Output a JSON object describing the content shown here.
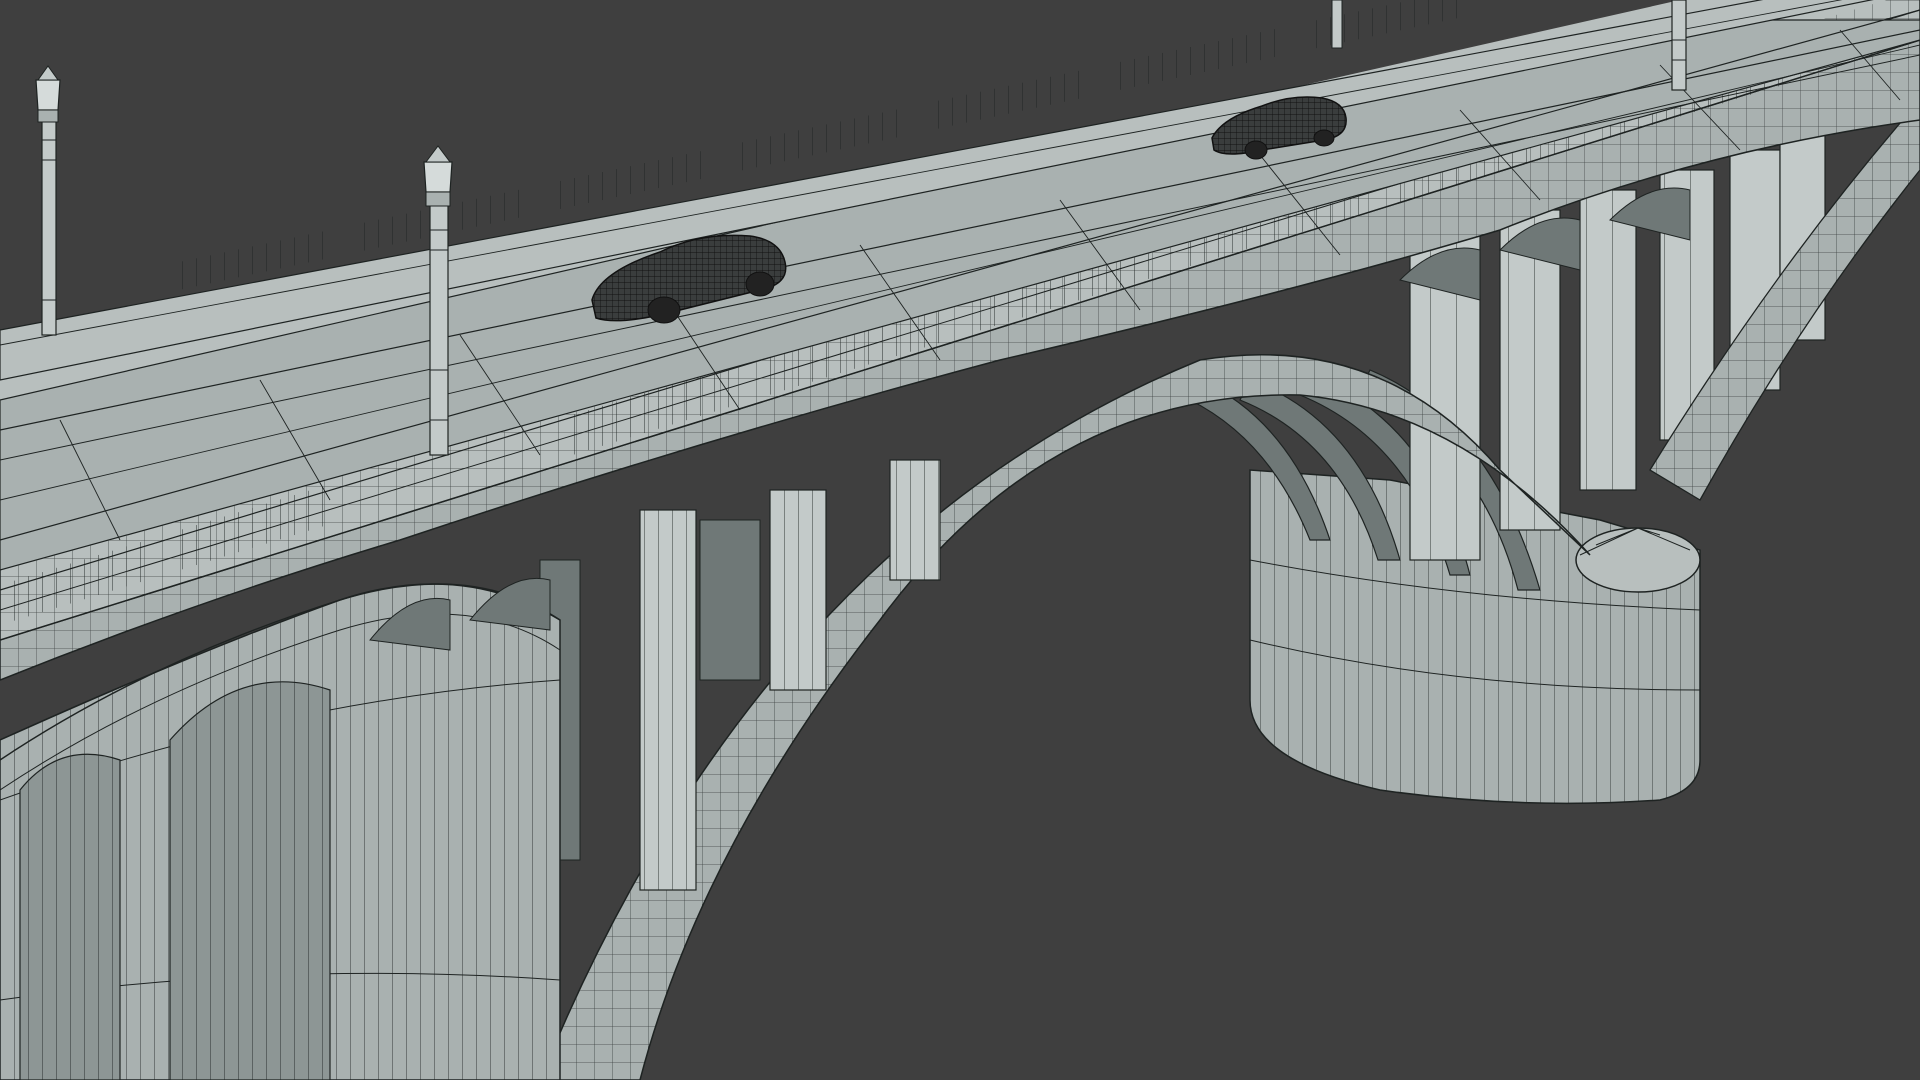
{
  "viewport": {
    "background_color": "#3f3f3f",
    "shading": "wireframe-on-shaded",
    "surface_color": "#a9b1b0",
    "surface_light_color": "#c3cac9",
    "surface_shadow_color": "#6f7877",
    "wire_color": "#1e2322"
  },
  "scene": {
    "objects": [
      {
        "name": "arch-bridge",
        "type": "mesh"
      },
      {
        "name": "bridge-deck",
        "type": "mesh"
      },
      {
        "name": "main-arch",
        "type": "mesh"
      },
      {
        "name": "river-pier",
        "type": "mesh"
      },
      {
        "name": "spandrel-columns",
        "type": "mesh"
      },
      {
        "name": "balustrade-near",
        "type": "mesh"
      },
      {
        "name": "balustrade-far",
        "type": "mesh"
      },
      {
        "name": "lamp-post",
        "type": "mesh",
        "count": 4
      },
      {
        "name": "car",
        "type": "mesh",
        "count": 2
      }
    ]
  }
}
